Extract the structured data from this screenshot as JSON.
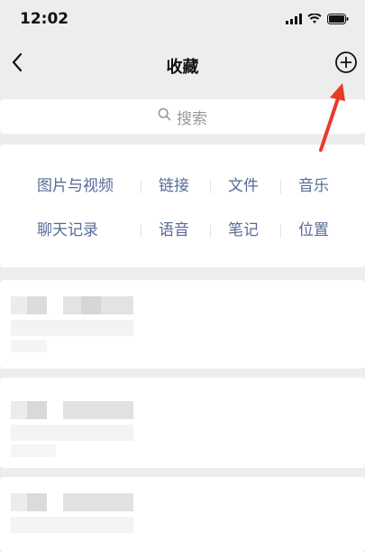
{
  "status_bar": {
    "time": "12:02",
    "icons": [
      "signal-icon",
      "wifi-icon",
      "battery-icon"
    ]
  },
  "nav": {
    "title": "收藏",
    "back_icon": "chevron-left-icon",
    "add_icon": "plus-circle-icon"
  },
  "search": {
    "placeholder": "搜索",
    "icon": "search-icon"
  },
  "categories": {
    "row1": [
      "图片与视频",
      "链接",
      "文件",
      "音乐"
    ],
    "row2": [
      "聊天记录",
      "语音",
      "笔记",
      "位置"
    ]
  },
  "colors": {
    "background": "#ededed",
    "card": "#ffffff",
    "link_blue": "#576b95",
    "annotation_red": "#e83a2a"
  }
}
